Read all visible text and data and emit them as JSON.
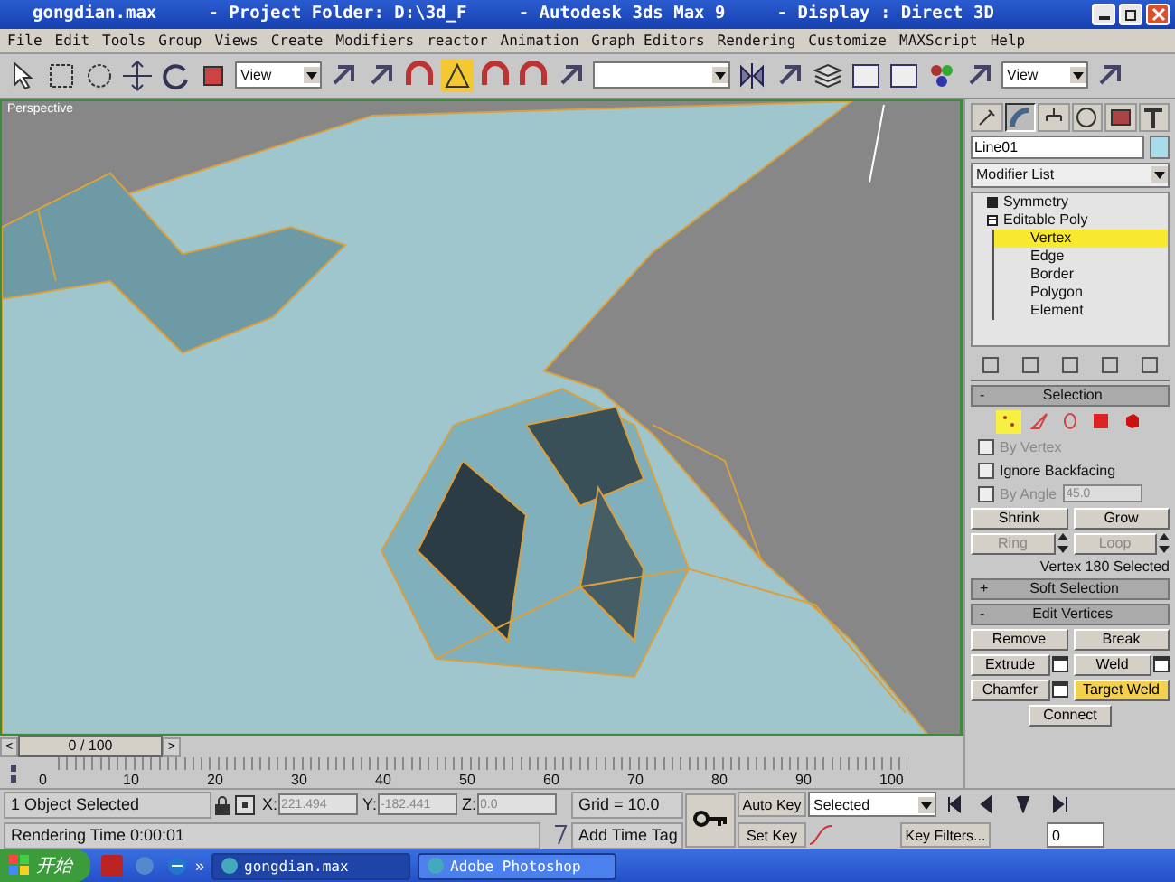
{
  "window": {
    "title": "gongdian.max     - Project Folder: D:\\3d_F     - Autodesk 3ds Max 9     - Display : Direct 3D"
  },
  "menu": [
    "File",
    "Edit",
    "Tools",
    "Group",
    "Views",
    "Create",
    "Modifiers",
    "reactor",
    "Animation",
    "Graph Editors",
    "Rendering",
    "Customize",
    "MAXScript",
    "Help"
  ],
  "toolbar": {
    "view_dropdowns": [
      "View",
      "View"
    ]
  },
  "viewport": {
    "label": "Perspective"
  },
  "time_slider": {
    "prev": "<",
    "label": "0 / 100",
    "next": ">"
  },
  "ruler": {
    "ticks": [
      "0",
      "10",
      "20",
      "30",
      "40",
      "50",
      "60",
      "70",
      "80",
      "90",
      "100"
    ]
  },
  "command_panel": {
    "tabs": [
      {
        "kind": "create",
        "selected": false
      },
      {
        "kind": "modify",
        "selected": true
      },
      {
        "kind": "hierarchy",
        "selected": false
      },
      {
        "kind": "motion",
        "selected": false
      },
      {
        "kind": "display",
        "selected": false
      },
      {
        "kind": "utilities",
        "selected": false
      }
    ],
    "object_name": "Line01",
    "modifier_list": "Modifier List",
    "stack": [
      {
        "label": "Symmetry",
        "expanded": false
      },
      {
        "label": "Editable Poly",
        "expanded": true,
        "children": [
          {
            "label": "Vertex",
            "selected": true
          },
          {
            "label": "Edge",
            "selected": false
          },
          {
            "label": "Border",
            "selected": false
          },
          {
            "label": "Polygon",
            "selected": false
          },
          {
            "label": "Element",
            "selected": false
          }
        ]
      }
    ],
    "selection": {
      "sign": "-",
      "title": "Selection",
      "subobjects": [
        {
          "kind": "vertex",
          "selected": true
        },
        {
          "kind": "edge",
          "selected": false
        },
        {
          "kind": "border",
          "selected": false
        },
        {
          "kind": "polygon",
          "selected": false
        },
        {
          "kind": "element",
          "selected": false
        }
      ],
      "checkboxes": [
        {
          "label": "By Vertex",
          "checked": false,
          "disabled": true
        },
        {
          "label": "Ignore Backfacing",
          "checked": false,
          "disabled": false
        },
        {
          "label": "By Angle",
          "checked": false,
          "disabled": true,
          "value": "45.0"
        }
      ],
      "buttons": [
        {
          "label": "Shrink",
          "disabled": false,
          "spinner": false
        },
        {
          "label": "Grow",
          "disabled": false,
          "spinner": false
        },
        {
          "label": "Ring",
          "disabled": true,
          "spinner": true
        },
        {
          "label": "Loop",
          "disabled": true,
          "spinner": true
        }
      ],
      "status": "Vertex 180 Selected"
    },
    "soft_selection": {
      "sign": "+",
      "title": "Soft Selection"
    },
    "edit_vertices": {
      "sign": "-",
      "title": "Edit Vertices",
      "buttons": [
        {
          "label": "Remove",
          "settings": false,
          "active": false
        },
        {
          "label": "Break",
          "settings": false,
          "active": false
        },
        {
          "label": "Extrude",
          "settings": true,
          "active": false
        },
        {
          "label": "Weld",
          "settings": true,
          "active": false
        },
        {
          "label": "Chamfer",
          "settings": true,
          "active": false
        },
        {
          "label": "Target Weld",
          "settings": false,
          "active": true
        }
      ],
      "connect": "Connect"
    }
  },
  "status_bar": {
    "selection": "1 Object Selected",
    "coords": [
      {
        "label": "X:",
        "value": "221.494"
      },
      {
        "label": "Y:",
        "value": "-182.441"
      },
      {
        "label": "Z:",
        "value": "0.0"
      }
    ],
    "grid": "Grid = 10.0",
    "rendering_time": "Rendering Time  0:00:01",
    "time_tag": "Add Time Tag",
    "auto_key": "Auto Key",
    "key_mode": "Selected",
    "set_key": "Set Key",
    "key_filters": "Key Filters...",
    "frame": "0"
  },
  "taskbar": {
    "start": "开始",
    "more": "»",
    "tasks": [
      {
        "label": "gongdian.max",
        "selected": true
      },
      {
        "label": "Adobe Photoshop",
        "selected": false
      }
    ]
  }
}
